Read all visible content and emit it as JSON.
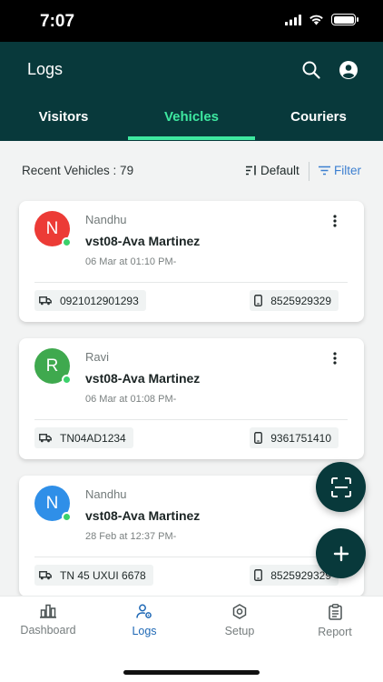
{
  "status_bar": {
    "time": "7:07"
  },
  "header": {
    "title": "Logs",
    "tabs": [
      {
        "label": "Visitors"
      },
      {
        "label": "Vehicles"
      },
      {
        "label": "Couriers"
      }
    ],
    "active_tab": "Vehicles"
  },
  "summary": {
    "label": "Recent Vehicles : 79",
    "sort_label": "Default",
    "filter_label": "Filter"
  },
  "cards": [
    {
      "initial": "N",
      "avatar_color": "#ec3b36",
      "person": "Nandhu",
      "vehicle": "vst08-Ava Martinez",
      "time": "06 Mar at 01:10 PM-",
      "plate": "0921012901293",
      "phone": "8525929329"
    },
    {
      "initial": "R",
      "avatar_color": "#3fa94e",
      "person": "Ravi",
      "vehicle": "vst08-Ava Martinez",
      "time": "06 Mar at 01:08 PM-",
      "plate": "TN04AD1234",
      "phone": "9361751410"
    },
    {
      "initial": "N",
      "avatar_color": "#2f8fe8",
      "person": "Nandhu",
      "vehicle": "vst08-Ava Martinez",
      "time": "28 Feb at 12:37 PM-",
      "plate": "TN 45 UXUI 6678",
      "phone": "8525929329"
    }
  ],
  "bottom_nav": [
    {
      "label": "Dashboard",
      "icon": "bar-chart-icon"
    },
    {
      "label": "Logs",
      "icon": "user-gear-icon"
    },
    {
      "label": "Setup",
      "icon": "hexagon-gear-icon"
    },
    {
      "label": "Report",
      "icon": "clipboard-icon"
    }
  ],
  "colors": {
    "header_bg": "#08393b",
    "active_tab": "#3ee8a0",
    "active_nav": "#1e68b5",
    "filter": "#3c7fd0"
  }
}
